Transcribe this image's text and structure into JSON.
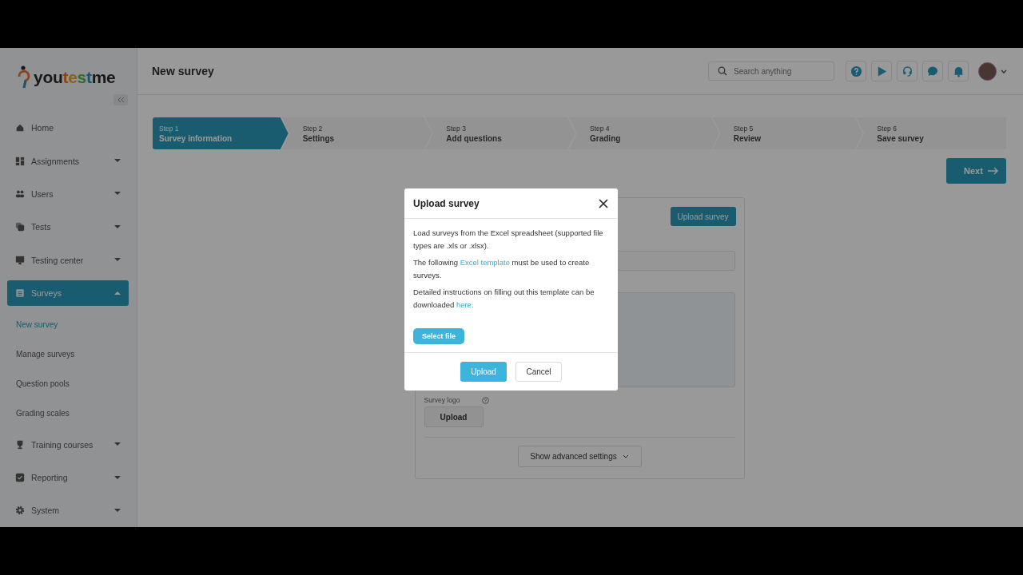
{
  "logo": {
    "parts": [
      "you",
      "t",
      "e",
      "s",
      "t",
      "me"
    ]
  },
  "sidebar": {
    "items": [
      {
        "label": "Home",
        "kind": "link",
        "selected": false
      },
      {
        "label": "Assignments",
        "kind": "group",
        "expanded": false,
        "selected": false
      },
      {
        "label": "Users",
        "kind": "group",
        "expanded": false,
        "selected": false
      },
      {
        "label": "Tests",
        "kind": "group",
        "expanded": false,
        "selected": false
      },
      {
        "label": "Testing center",
        "kind": "group",
        "expanded": false,
        "selected": false
      },
      {
        "label": "Surveys",
        "kind": "group",
        "expanded": true,
        "selected": true,
        "children": [
          {
            "label": "New survey",
            "selected": true
          },
          {
            "label": "Manage surveys",
            "selected": false
          },
          {
            "label": "Question pools",
            "selected": false
          },
          {
            "label": "Grading scales",
            "selected": false
          }
        ]
      },
      {
        "label": "Training courses",
        "kind": "group",
        "expanded": false,
        "selected": false
      },
      {
        "label": "Reporting",
        "kind": "group",
        "expanded": false,
        "selected": false
      },
      {
        "label": "System",
        "kind": "group",
        "expanded": false,
        "selected": false
      }
    ]
  },
  "header": {
    "title": "New survey",
    "search": {
      "placeholder": "Search anything"
    }
  },
  "steps": [
    {
      "number": "Step 1",
      "label": "Survey information",
      "selected": true
    },
    {
      "number": "Step 2",
      "label": "Settings",
      "selected": false
    },
    {
      "number": "Step 3",
      "label": "Add questions",
      "selected": false
    },
    {
      "number": "Step 4",
      "label": "Grading",
      "selected": false
    },
    {
      "number": "Step 5",
      "label": "Review",
      "selected": false
    },
    {
      "number": "Step 6",
      "label": "Save survey",
      "selected": false
    }
  ],
  "next_button": "Next",
  "form": {
    "upload_survey_button": "Upload survey",
    "logo_label": "Survey logo",
    "logo_upload_button": "Upload",
    "advanced_button": "Show advanced settings"
  },
  "dialog": {
    "title": "Upload survey",
    "paragraphs": [
      [
        {
          "text": "Load surveys from the Excel spreadsheet (supported file types are .xls or .xlsx)."
        }
      ],
      [
        {
          "text": "The following "
        },
        {
          "text": "Excel template",
          "link": true
        },
        {
          "text": " must be used to create surveys."
        }
      ],
      [
        {
          "text": "Detailed instructions on filling out this template can be downloaded "
        },
        {
          "text": "here.",
          "link": true
        }
      ]
    ],
    "select_file_button": "Select file",
    "upload_button": "Upload",
    "cancel_button": "Cancel"
  }
}
